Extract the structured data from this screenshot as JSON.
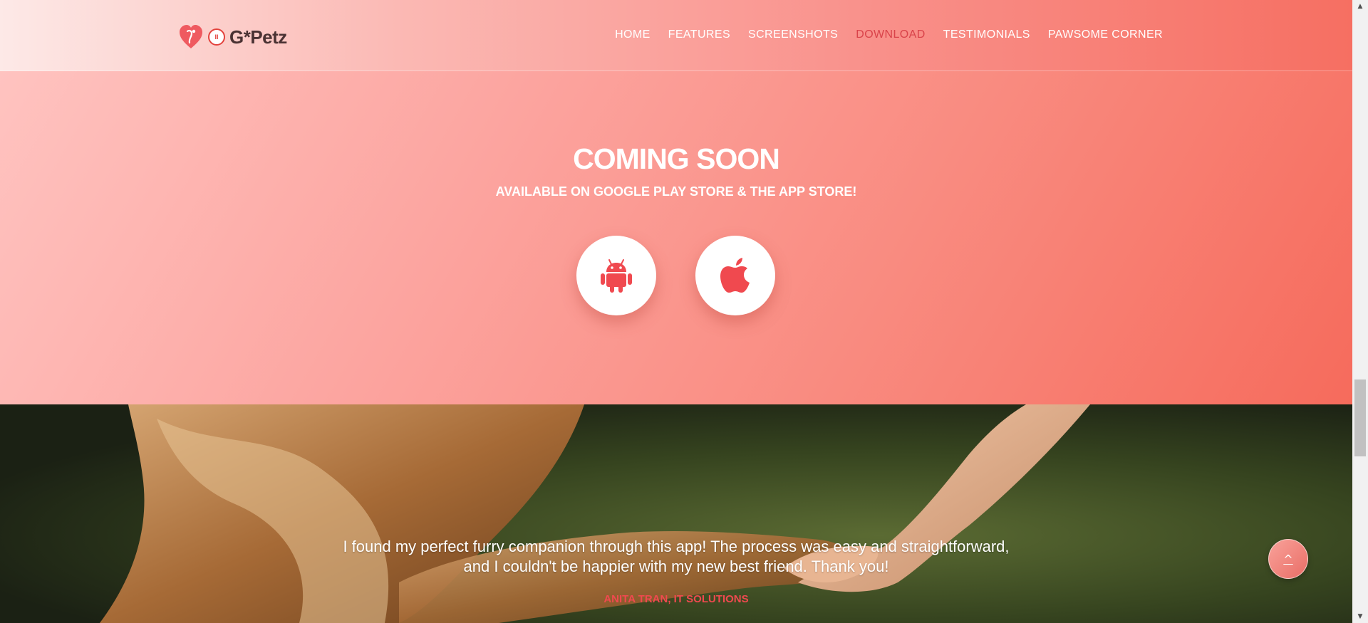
{
  "header": {
    "logo": {
      "badge_text": "II",
      "brand_text": "G*Petz"
    },
    "nav": [
      {
        "label": "HOME",
        "active": false
      },
      {
        "label": "FEATURES",
        "active": false
      },
      {
        "label": "SCREENSHOTS",
        "active": false
      },
      {
        "label": "DOWNLOAD",
        "active": true
      },
      {
        "label": "TESTIMONIALS",
        "active": false
      },
      {
        "label": "PAWSOME CORNER",
        "active": false
      }
    ]
  },
  "download": {
    "title": "COMING SOON",
    "subtitle": "AVAILABLE ON GOOGLE PLAY STORE & THE APP STORE!",
    "buttons": [
      {
        "icon": "android-icon"
      },
      {
        "icon": "apple-icon"
      }
    ]
  },
  "testimonial": {
    "quote_line1": "I found my perfect furry companion through this app! The process was easy and straightforward,",
    "quote_line2": "and I couldn't be happier with my new best friend. Thank you!",
    "author": "ANITA TRAN, IT SOLUTIONS"
  },
  "back_to_top": {
    "label": "^"
  },
  "colors": {
    "accent": "#f0494f",
    "active_nav": "#d9434a",
    "hero_start": "#ffc3c0",
    "hero_end": "#f66b5c"
  }
}
